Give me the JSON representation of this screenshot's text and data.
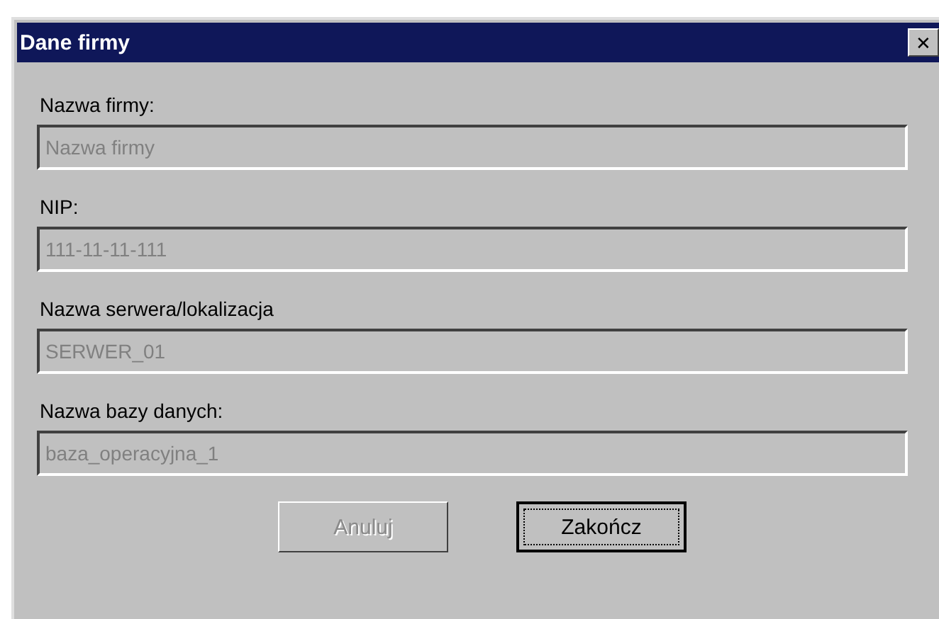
{
  "window": {
    "title": "Dane firmy",
    "close": "✕"
  },
  "fields": [
    {
      "label": "Nazwa firmy:",
      "value": "Nazwa firmy",
      "disabled": true
    },
    {
      "label": "NIP:",
      "value": "111-11-11-111",
      "disabled": true
    },
    {
      "label": "Nazwa serwera/lokalizacja",
      "value": "SERWER_01",
      "disabled": true
    },
    {
      "label": "Nazwa bazy danych:",
      "value": "baza_operacyjna_1",
      "disabled": true
    }
  ],
  "buttons": [
    {
      "label": "Anuluj",
      "disabled": true,
      "default": false
    },
    {
      "label": "Zakończ",
      "disabled": false,
      "default": true
    }
  ]
}
